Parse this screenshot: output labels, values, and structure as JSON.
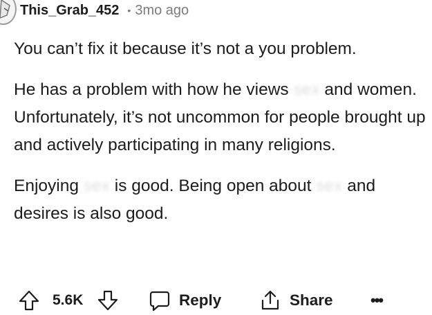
{
  "comment": {
    "author": "This_Grab_452",
    "separator": "•",
    "age": "3mo ago",
    "paragraphs": [
      {
        "text": "You can’t fix it because it’s not a you problem."
      },
      {
        "before": "He has a problem with how he views ",
        "redacted": "sex",
        "after": " and women. Unfortunately, it’s not uncommon for people brought up and actively participating in many religions."
      },
      {
        "p3_a": "Enjoying ",
        "p3_r1": "sex",
        "p3_b": " is good. Being open about ",
        "p3_r2": "sex",
        "p3_c": " and desires is also good."
      }
    ]
  },
  "actions": {
    "upvote_icon": "arrow-up-icon",
    "score": "5.6K",
    "downvote_icon": "arrow-down-icon",
    "reply_icon": "speech-bubble-icon",
    "reply_label": "Reply",
    "share_icon": "share-icon",
    "share_label": "Share",
    "more_label": "•••"
  },
  "colors": {
    "text": "#1c1c1c",
    "muted": "#7c7c7c",
    "background": "#ffffff"
  }
}
